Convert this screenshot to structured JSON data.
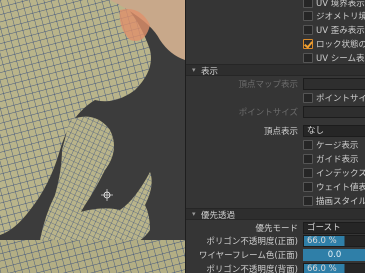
{
  "viewport": {
    "colors": {
      "background": "#3c3c3c",
      "mesh_fill": "#b9b48a",
      "mesh_line": "#1f3a7a",
      "highlight": "#e0906a"
    }
  },
  "panel": {
    "top_options": [
      {
        "label": "UV 境界表示",
        "checked": false
      },
      {
        "label": "ジオメトリ境界表示",
        "checked": false
      },
      {
        "label": "UV 歪み表示",
        "checked": false
      },
      {
        "label": "ロック状態のメッシュ",
        "checked": true
      },
      {
        "label": "UV シーム表示",
        "checked": false
      }
    ],
    "display_section": {
      "title": "表示",
      "vertex_map_label": "頂点マップ表示",
      "point_size_checkbox": "ポイントサイズ独立",
      "point_size_label": "ポイントサイズ",
      "vertex_display_label": "頂点表示",
      "vertex_display_value": "なし",
      "options": [
        {
          "label": "ケージ表示",
          "checked": false
        },
        {
          "label": "ガイド表示",
          "checked": false
        },
        {
          "label": "インデックス表示",
          "checked": false
        },
        {
          "label": "ウェイト値表示",
          "checked": false
        },
        {
          "label": "描画スタイル独立",
          "checked": false
        }
      ]
    },
    "priority_section": {
      "title": "優先透過",
      "mode_label": "優先モード",
      "mode_value": "ゴースト",
      "poly_opacity_front_label": "ポリゴン不透明度(正面)",
      "poly_opacity_front_value": "66.0 %",
      "poly_opacity_front_fill": 0.66,
      "wire_color_front_label": "ワイヤーフレーム色(正面)",
      "wire_color_front_value": "0.0",
      "poly_opacity_back_label": "ポリゴン不透明度(背面)",
      "poly_opacity_back_value": "66.0 %",
      "poly_opacity_back_fill": 0.66
    }
  }
}
